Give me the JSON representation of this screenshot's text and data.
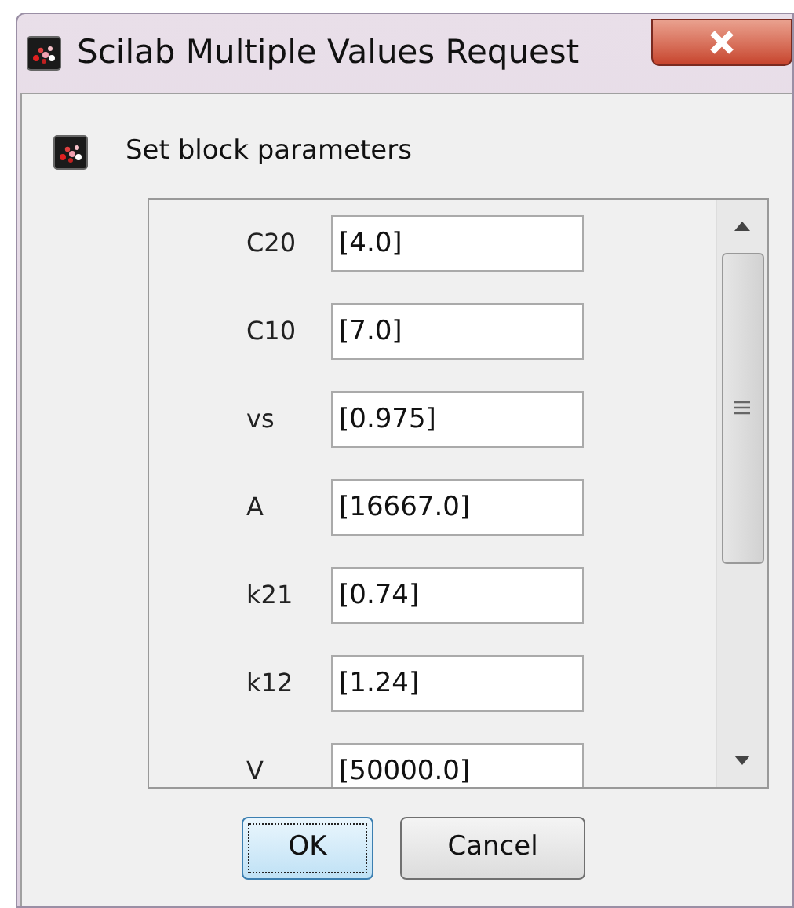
{
  "window": {
    "title": "Scilab Multiple Values Request"
  },
  "header": {
    "text": "Set block parameters"
  },
  "fields": [
    {
      "label": "C20",
      "value": "[4.0]"
    },
    {
      "label": "C10",
      "value": "[7.0]"
    },
    {
      "label": "vs",
      "value": "[0.975]"
    },
    {
      "label": "A",
      "value": "[16667.0]"
    },
    {
      "label": "k21",
      "value": "[0.74]"
    },
    {
      "label": "k12",
      "value": "[1.24]"
    },
    {
      "label": "V",
      "value": "[50000.0]"
    }
  ],
  "buttons": [
    {
      "label": "OK",
      "focused": true
    },
    {
      "label": "Cancel",
      "focused": false
    }
  ]
}
